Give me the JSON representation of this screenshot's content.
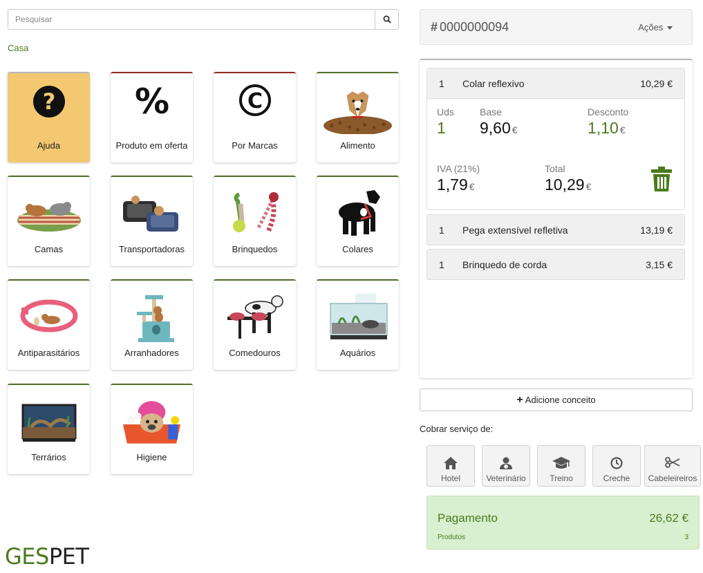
{
  "search": {
    "placeholder": "Pesquisar",
    "icon": "search-icon"
  },
  "breadcrumb": "Casa",
  "categories": [
    {
      "label": "Ajuda",
      "icon": "help-icon"
    },
    {
      "label": "Produto em oferta",
      "icon": "percent-icon"
    },
    {
      "label": "Por Marcas",
      "icon": "copyright-icon"
    },
    {
      "label": "Alimento",
      "icon": "dog-food-photo"
    },
    {
      "label": "Camas",
      "icon": "pet-bed-photo"
    },
    {
      "label": "Transportadoras",
      "icon": "pet-carrier-photo"
    },
    {
      "label": "Brinquedos",
      "icon": "rope-toy-photo"
    },
    {
      "label": "Colares",
      "icon": "dog-harness-photo"
    },
    {
      "label": "Antiparasitários",
      "icon": "flea-collar-photo"
    },
    {
      "label": "Arranhadores",
      "icon": "cat-tree-photo"
    },
    {
      "label": "Comedouros",
      "icon": "feeder-photo"
    },
    {
      "label": "Aquários",
      "icon": "aquarium-photo"
    },
    {
      "label": "Terrários",
      "icon": "terrarium-photo"
    },
    {
      "label": "Higiene",
      "icon": "dog-bath-photo"
    }
  ],
  "logo": {
    "part1": "GES",
    "part2": "PET"
  },
  "order": {
    "hash": "#",
    "number": "0000000094",
    "actions": "Ações"
  },
  "lines": [
    {
      "qty": "1",
      "name": "Colar reflexivo",
      "price": "10,29 €",
      "details": {
        "uds_label": "Uds",
        "uds": "1",
        "base_label": "Base",
        "base": "9,60",
        "discount_label": "Desconto",
        "discount": "1,10",
        "iva_label": "IVA (21%)",
        "iva": "1,79",
        "total_label": "Total",
        "total": "10,29",
        "currency": "€"
      }
    },
    {
      "qty": "1",
      "name": "Pega extensível refletiva",
      "price": "13,19 €"
    },
    {
      "qty": "1",
      "name": "Brinquedo de corda",
      "price": "3,15 €"
    }
  ],
  "add_concept": "Adicione conceito",
  "services_title": "Cobrar serviço de:",
  "services": [
    {
      "label": "Hotel",
      "icon": "home-icon"
    },
    {
      "label": "Veterinário",
      "icon": "doctor-icon"
    },
    {
      "label": "Treino",
      "icon": "graduation-cap-icon"
    },
    {
      "label": "Creche",
      "icon": "clock-icon"
    },
    {
      "label": "Cabeleireiros",
      "icon": "scissors-icon"
    }
  ],
  "payment": {
    "label": "Pagamento",
    "amount": "26,62 €",
    "products_label": "Produtos",
    "products_count": "3"
  },
  "colors": {
    "accent_green": "#4a7a1e",
    "help_tile": "#f3c870",
    "payment_bg": "#d8f0cf",
    "tile_border_green": "#4e6e2a",
    "tile_border_red": "#8c2b23"
  }
}
